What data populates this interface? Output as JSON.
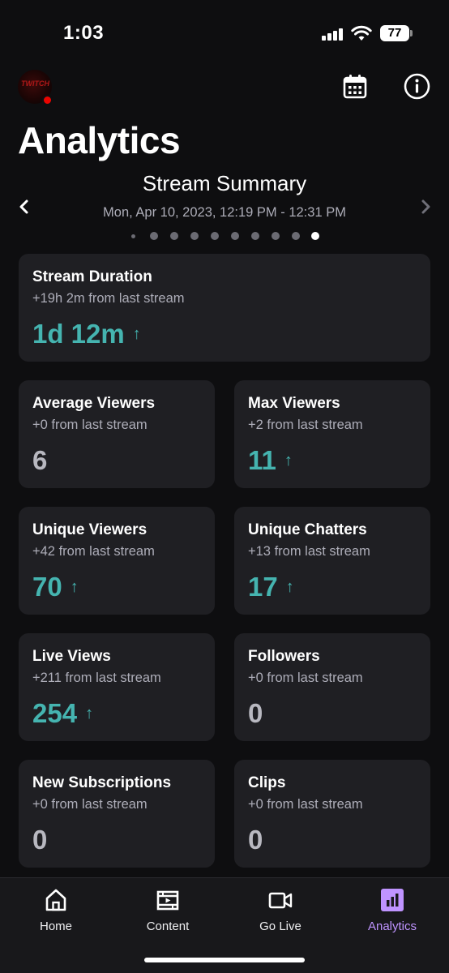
{
  "status_bar": {
    "time": "1:03",
    "battery": "77"
  },
  "header": {
    "title": "Analytics",
    "avatar_text": "TWITCH",
    "icons": {
      "calendar": "calendar-icon",
      "info": "info-icon"
    }
  },
  "summary": {
    "title": "Stream Summary",
    "date_range": "Mon, Apr 10, 2023, 12:19 PM - 12:31 PM",
    "page_count": 10,
    "active_page": 10
  },
  "cards": {
    "stream_duration": {
      "title": "Stream Duration",
      "sub": "+19h 2m from last stream",
      "value": "1d 12m",
      "arrow": "↑"
    },
    "average_viewers": {
      "title": "Average Viewers",
      "sub": "+0 from last stream",
      "value": "6"
    },
    "max_viewers": {
      "title": "Max Viewers",
      "sub": "+2 from last stream",
      "value": "11",
      "arrow": "↑"
    },
    "unique_viewers": {
      "title": "Unique Viewers",
      "sub": "+42 from last stream",
      "value": "70",
      "arrow": "↑"
    },
    "unique_chatters": {
      "title": "Unique Chatters",
      "sub": "+13 from last stream",
      "value": "17",
      "arrow": "↑"
    },
    "live_views": {
      "title": "Live Views",
      "sub": "+211 from last stream",
      "value": "254",
      "arrow": "↑"
    },
    "followers": {
      "title": "Followers",
      "sub": "+0 from last stream",
      "value": "0"
    },
    "new_subscriptions": {
      "title": "New Subscriptions",
      "sub": "+0 from last stream",
      "value": "0"
    },
    "clips": {
      "title": "Clips",
      "sub": "+0 from last stream",
      "value": "0"
    }
  },
  "nav": {
    "home": "Home",
    "content": "Content",
    "go_live": "Go Live",
    "analytics": "Analytics",
    "active": "analytics"
  },
  "colors": {
    "background": "#0e0e10",
    "card": "#1f1f23",
    "increase": "#45b4b0",
    "accent": "#bf94ff",
    "live": "#eb0400"
  }
}
